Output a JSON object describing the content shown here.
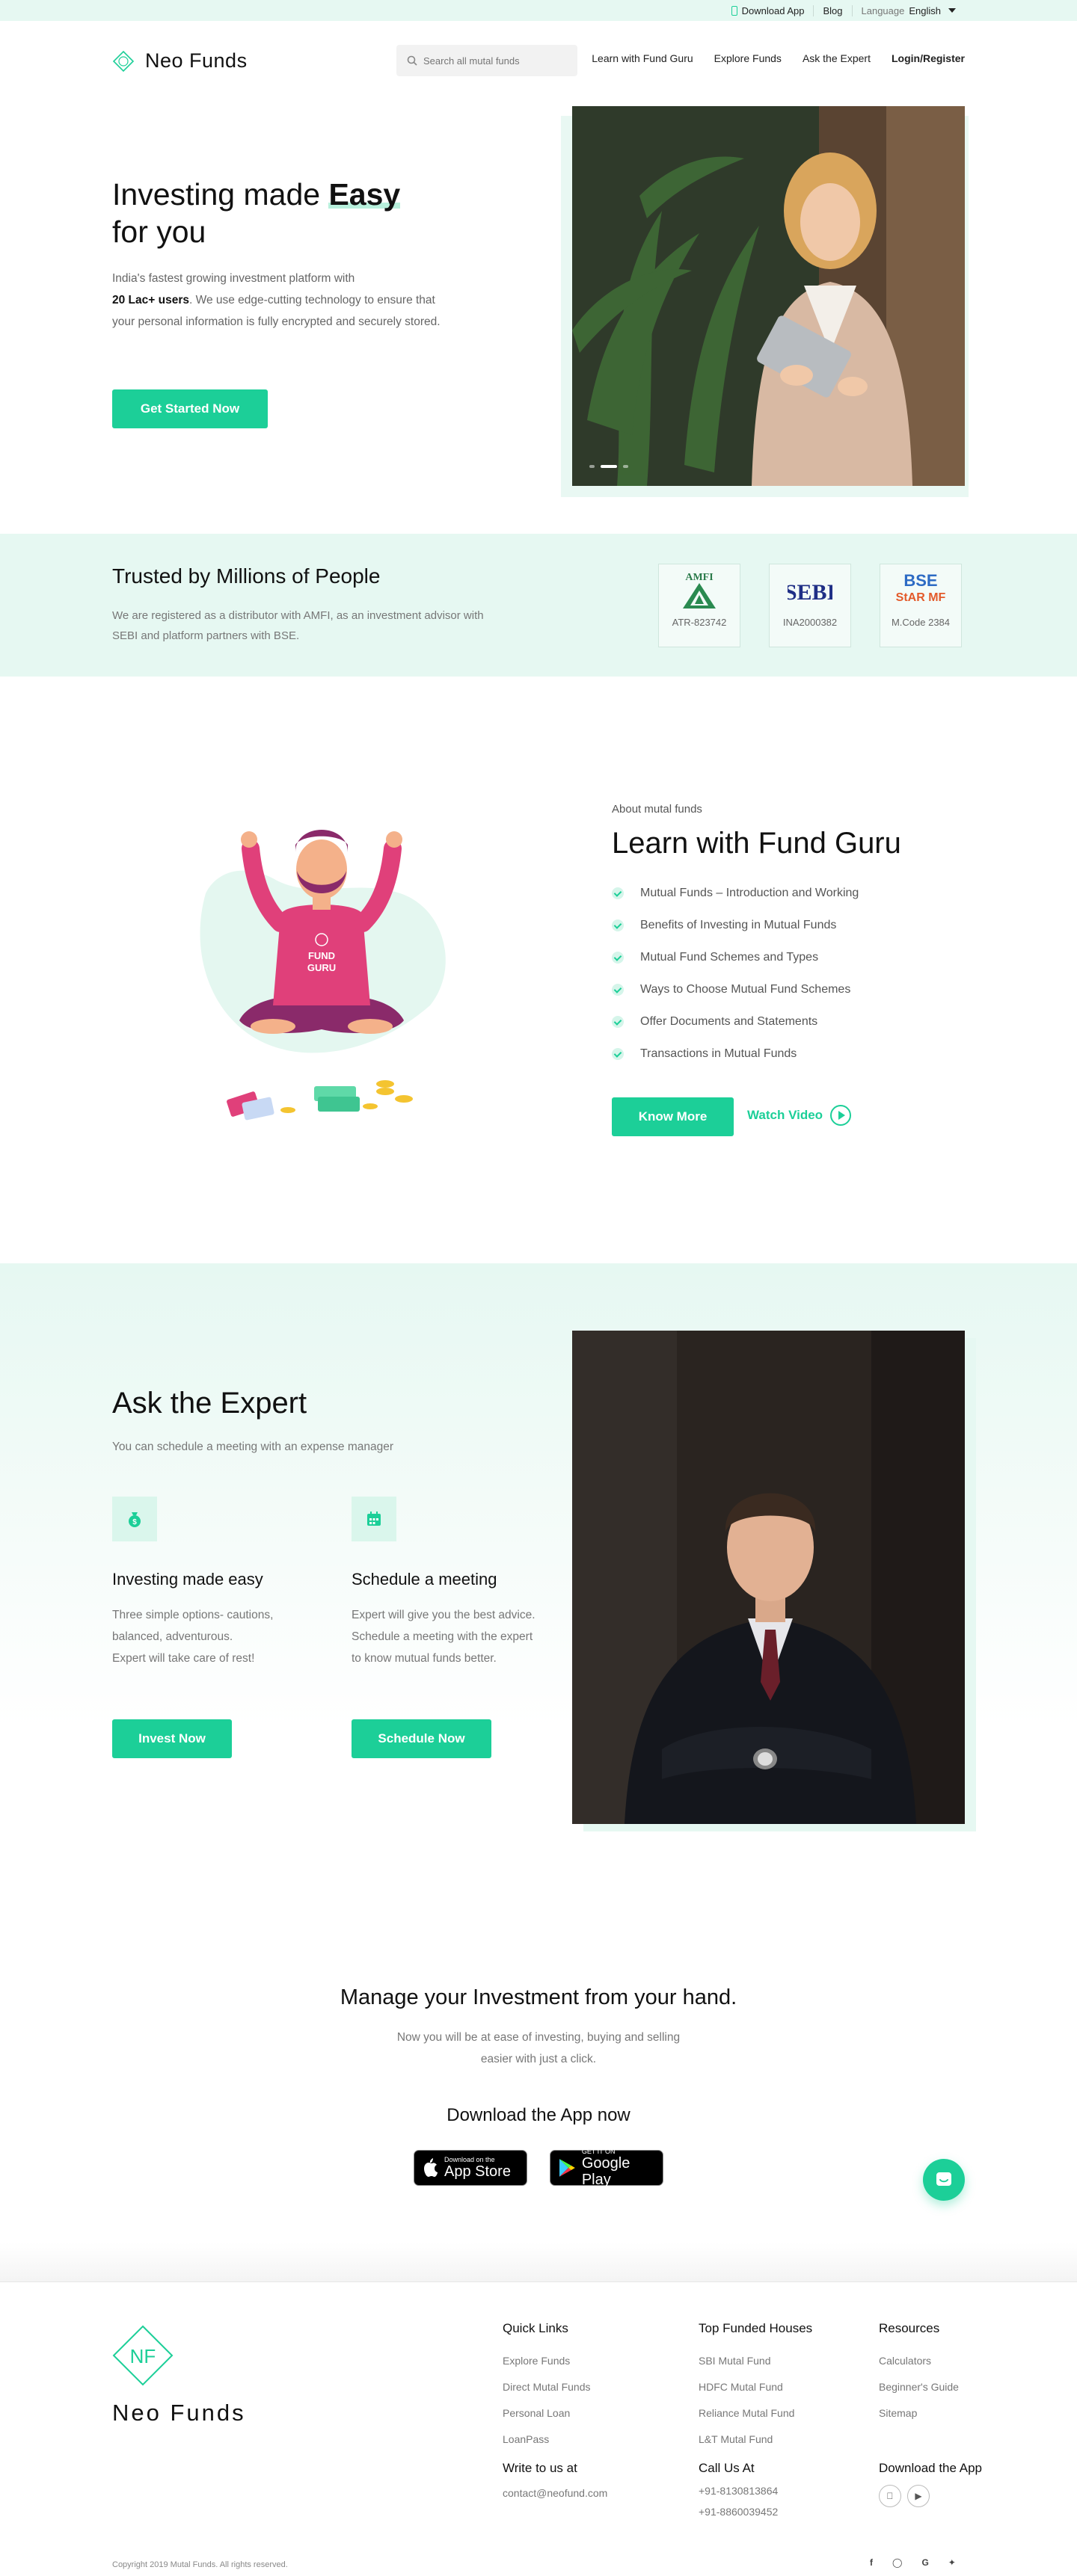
{
  "topbar": {
    "download_app": "Download App",
    "blog": "Blog",
    "language_label": "Language",
    "language_value": "English"
  },
  "header": {
    "brand": "Neo Funds",
    "search_placeholder": "Search all mutal funds",
    "nav": [
      "Learn with Fund Guru",
      "Explore Funds",
      "Ask the Expert",
      "Login/Register"
    ]
  },
  "hero": {
    "title_line1_pre": "Investing made ",
    "title_line1_em": "Easy",
    "title_line2": "for you",
    "desc_pre": "India's fastest growing investment platform with",
    "desc_bold": "20 Lac+ users",
    "desc_post": ". We use edge-cutting technology to ensure that your personal information is fully encrypted and securely stored.",
    "cta": "Get Started Now",
    "slides_total": 3,
    "slide_active": 2
  },
  "trusted": {
    "title": "Trusted by Millions of People",
    "desc": "We are registered as a distributor with AMFI, as an investment advisor with SEBI and platform partners with BSE.",
    "badges": [
      {
        "logo_text": "AMFI",
        "code": "ATR-823742"
      },
      {
        "logo_text": "SEBI",
        "code": "INA2000382"
      },
      {
        "logo_text": "BSE StAR MF",
        "code": "M.Code 2384"
      }
    ]
  },
  "guru": {
    "eyebrow": "About mutal funds",
    "title": "Learn with Fund Guru",
    "illustration_text": "FUND GURU",
    "items": [
      "Mutual Funds – Introduction and Working",
      "Benefits of Investing in Mutual Funds",
      "Mutual Fund Schemes and Types",
      "Ways to Choose Mutual Fund Schemes",
      "Offer Documents and Statements",
      "Transactions in Mutual Funds"
    ],
    "cta": "Know More",
    "video": "Watch Video"
  },
  "expert": {
    "title": "Ask the Expert",
    "subtitle": "You can schedule a meeting with an expense manager",
    "features": [
      {
        "title": "Investing made easy",
        "desc": "Three simple options- cautions, balanced, adventurous.\nExpert will take care of rest!",
        "cta": "Invest Now"
      },
      {
        "title": "Schedule a meeting",
        "desc": "Expert will give you the best advice. Schedule a meeting with the expert to know mutual funds better.",
        "cta": "Schedule Now"
      }
    ]
  },
  "app": {
    "title": "Manage your Investment from your hand.",
    "subtitle": "Now you will be at ease of investing, buying and selling easier with just a click.",
    "download_title": "Download the App now",
    "appstore_small": "Download on the",
    "appstore_big": "App Store",
    "play_small": "GET IT ON",
    "play_big": "Google Play"
  },
  "footer": {
    "brand": "Neo Funds",
    "brand_mark": "NF",
    "quick_links_title": "Quick Links",
    "quick_links": [
      "Explore Funds",
      "Direct Mutal Funds",
      "Personal Loan",
      "LoanPass"
    ],
    "houses_title": "Top Funded Houses",
    "houses": [
      "SBI Mutal Fund",
      "HDFC Mutal Fund",
      "Reliance Mutal Fund",
      "L&T Mutal Fund"
    ],
    "resources_title": "Resources",
    "resources": [
      "Calculators",
      "Beginner's Guide",
      "Sitemap"
    ],
    "write_title": "Write to us at",
    "email": "contact@neofund.com",
    "call_title": "Call Us At",
    "phones": [
      "+91-8130813864",
      "+91-8860039452"
    ],
    "app_title": "Download the App",
    "copyright": "Copyright 2019 Mutal Funds. All rights reserved."
  },
  "colors": {
    "accent": "#1ccf98",
    "accent_light": "#e6f8f2"
  }
}
